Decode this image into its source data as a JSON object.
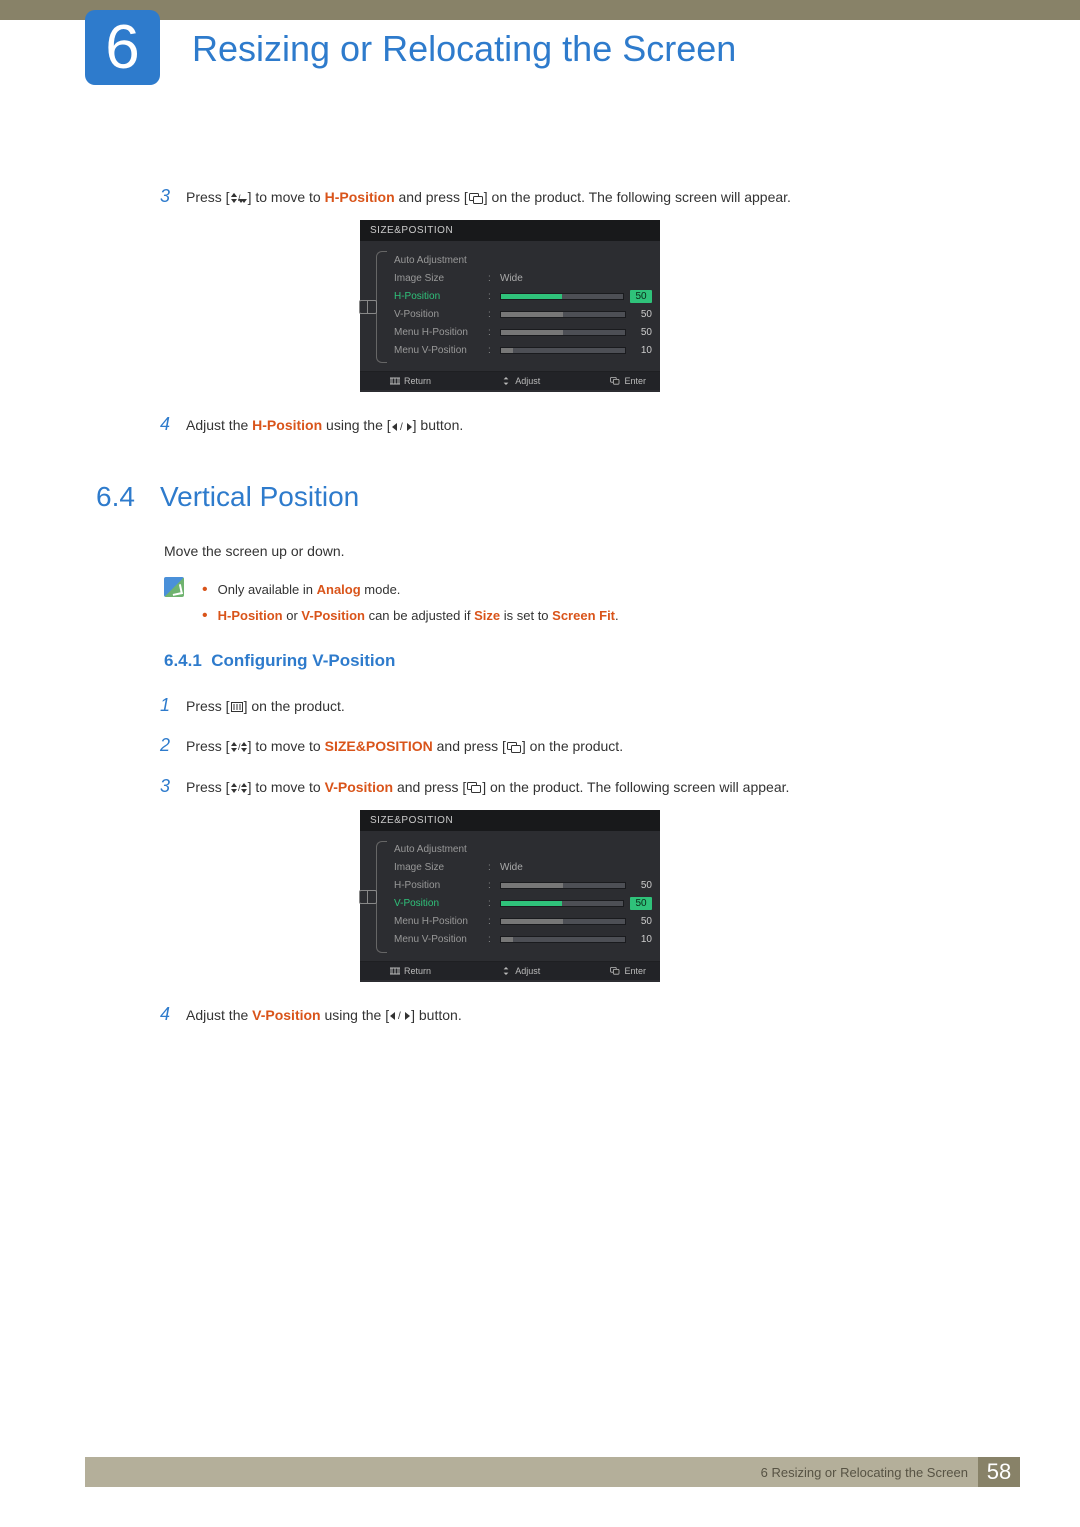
{
  "chapter": {
    "number": "6",
    "title": "Resizing or Relocating the Screen"
  },
  "steps_top": {
    "s3": {
      "n": "3",
      "pre": "Press [",
      "mid1": "] to move to ",
      "kw": "H-Position",
      "mid2": " and press [",
      "post": "] on the product. The following screen will appear."
    },
    "s4": {
      "n": "4",
      "pre": "Adjust the ",
      "kw": "H-Position",
      "mid": " using the [",
      "post": "] button."
    }
  },
  "osd1": {
    "title": "SIZE&POSITION",
    "rows": [
      {
        "label": "Auto Adjustment",
        "type": "blank"
      },
      {
        "label": "Image Size",
        "type": "text",
        "value": "Wide"
      },
      {
        "label": "H-Position",
        "type": "bar",
        "value": 50,
        "selected": true
      },
      {
        "label": "V-Position",
        "type": "bar",
        "value": 50
      },
      {
        "label": "Menu H-Position",
        "type": "bar",
        "value": 50
      },
      {
        "label": "Menu V-Position",
        "type": "bar",
        "value": 10
      }
    ],
    "footer": {
      "return": "Return",
      "adjust": "Adjust",
      "enter": "Enter"
    }
  },
  "section": {
    "num": "6.4",
    "title": "Vertical Position"
  },
  "section_para": "Move the screen up or down.",
  "notes": {
    "a": {
      "pre": "Only available in ",
      "kw": "Analog",
      "post": " mode."
    },
    "b": {
      "k1": "H-Position",
      "t1": " or ",
      "k2": "V-Position",
      "t2": " can be adjusted if ",
      "k3": "Size",
      "t3": " is set to ",
      "k4": "Screen Fit",
      "t4": "."
    }
  },
  "subsection": {
    "num": "6.4.1",
    "title": "Configuring V-Position"
  },
  "steps_bottom": {
    "s1": {
      "n": "1",
      "pre": "Press [",
      "post": "] on the product."
    },
    "s2": {
      "n": "2",
      "pre": "Press [",
      "mid1": "] to move to ",
      "kw": "SIZE&POSITION",
      "mid2": " and press [",
      "post": "] on the product."
    },
    "s3": {
      "n": "3",
      "pre": "Press [",
      "mid1": "] to move to ",
      "kw": "V-Position",
      "mid2": " and press [",
      "post": "] on the product. The following screen will appear."
    },
    "s4": {
      "n": "4",
      "pre": "Adjust the ",
      "kw": "V-Position",
      "mid": " using the [",
      "post": "] button."
    }
  },
  "osd2": {
    "title": "SIZE&POSITION",
    "rows": [
      {
        "label": "Auto Adjustment",
        "type": "blank"
      },
      {
        "label": "Image Size",
        "type": "text",
        "value": "Wide"
      },
      {
        "label": "H-Position",
        "type": "bar",
        "value": 50
      },
      {
        "label": "V-Position",
        "type": "bar",
        "value": 50,
        "selected": true
      },
      {
        "label": "Menu H-Position",
        "type": "bar",
        "value": 50
      },
      {
        "label": "Menu V-Position",
        "type": "bar",
        "value": 10
      }
    ],
    "footer": {
      "return": "Return",
      "adjust": "Adjust",
      "enter": "Enter"
    }
  },
  "footer": {
    "text": "6 Resizing or Relocating the Screen",
    "page": "58"
  }
}
